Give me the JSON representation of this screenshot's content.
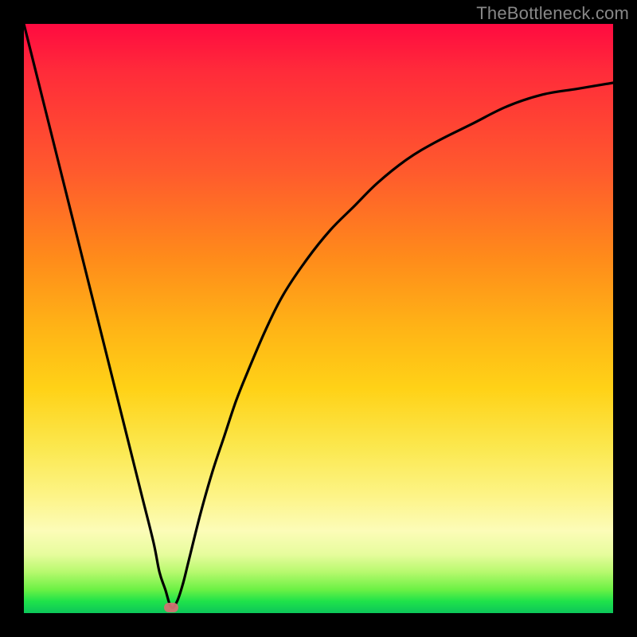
{
  "watermark": "TheBottleneck.com",
  "colors": {
    "frame": "#000000",
    "curve": "#000000",
    "marker": "#d07272"
  },
  "chart_data": {
    "type": "line",
    "title": "",
    "xlabel": "",
    "ylabel": "",
    "xlim": [
      0,
      100
    ],
    "ylim": [
      0,
      100
    ],
    "grid": false,
    "legend": false,
    "series": [
      {
        "name": "bottleneck_curve",
        "x": [
          0,
          2,
          4,
          6,
          8,
          10,
          12,
          14,
          16,
          18,
          20,
          22,
          23,
          24,
          25,
          26,
          27,
          28,
          30,
          32,
          34,
          36,
          38,
          41,
          44,
          48,
          52,
          56,
          60,
          65,
          70,
          76,
          82,
          88,
          94,
          100
        ],
        "y": [
          100,
          92,
          84,
          76,
          68,
          60,
          52,
          44,
          36,
          28,
          20,
          12,
          7,
          4,
          1,
          2,
          5,
          9,
          17,
          24,
          30,
          36,
          41,
          48,
          54,
          60,
          65,
          69,
          73,
          77,
          80,
          83,
          86,
          88,
          89,
          90
        ]
      }
    ],
    "markers": [
      {
        "name": "optimum_point",
        "x": 25,
        "y": 1
      }
    ],
    "background_gradient_meaning": "top=red=high bottleneck, bottom=green=low/no bottleneck"
  }
}
